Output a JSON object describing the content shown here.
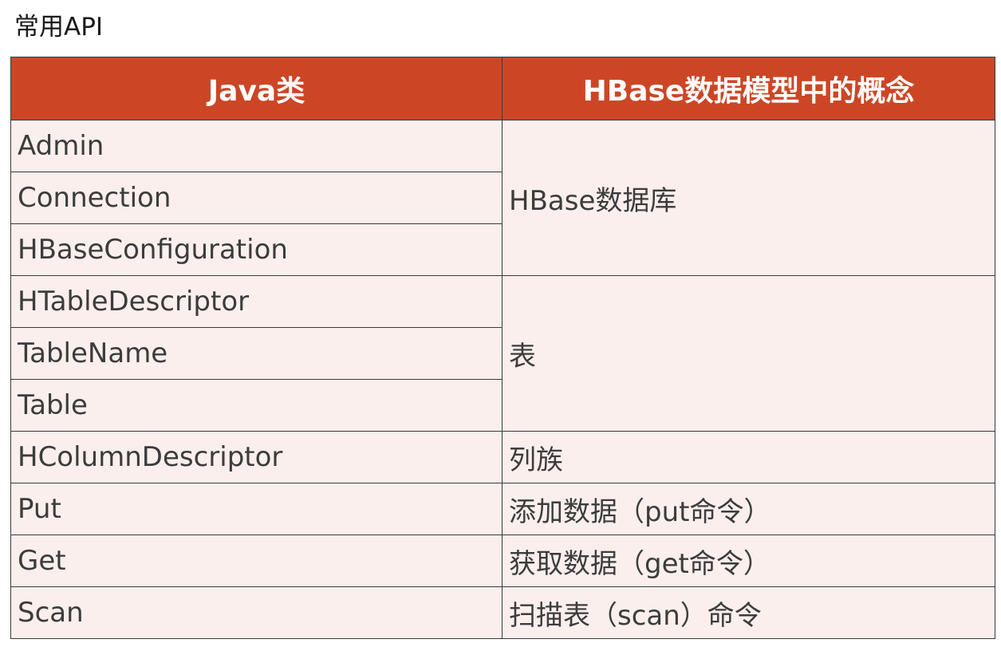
{
  "title": "常用API",
  "table": {
    "headers": [
      "Java类",
      "HBase数据模型中的概念"
    ],
    "groups": [
      {
        "concept": "HBase数据库",
        "classes": [
          "Admin",
          "Connection",
          "HBaseConfiguration"
        ]
      },
      {
        "concept": "表",
        "classes": [
          "HTableDescriptor",
          "TableName",
          "Table"
        ]
      },
      {
        "concept": "列族",
        "classes": [
          "HColumnDescriptor"
        ]
      },
      {
        "concept": "添加数据（put命令）",
        "classes": [
          "Put"
        ]
      },
      {
        "concept": "获取数据（get命令）",
        "classes": [
          "Get"
        ]
      },
      {
        "concept": "扫描表（scan）命令",
        "classes": [
          "Scan"
        ]
      }
    ]
  },
  "colors": {
    "header_bg": "#cc4626",
    "header_text": "#ffffff",
    "cell_bg": "#fbefee",
    "border": "#3a3a3a"
  }
}
